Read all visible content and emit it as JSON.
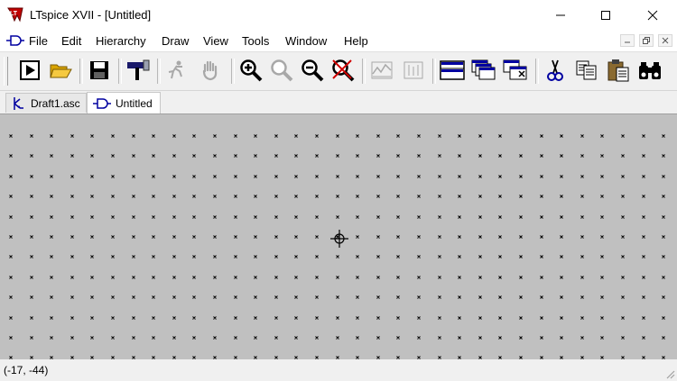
{
  "window": {
    "title": "LTspice XVII - [Untitled]"
  },
  "menu": {
    "items": [
      {
        "label": "File"
      },
      {
        "label": "Edit"
      },
      {
        "label": "Hierarchy"
      },
      {
        "label": "Draw"
      },
      {
        "label": "View"
      },
      {
        "label": "Tools"
      },
      {
        "label": "Window"
      },
      {
        "label": "Help"
      }
    ]
  },
  "toolbar": {
    "buttons": [
      {
        "icon": "run-icon"
      },
      {
        "icon": "open-folder-icon"
      },
      {
        "icon": "save-icon"
      },
      {
        "icon": "control-panel-hammer-icon"
      },
      {
        "icon": "halt-running-icon"
      },
      {
        "icon": "pan-hand-icon"
      },
      {
        "icon": "zoom-in-icon"
      },
      {
        "icon": "zoom-area-icon"
      },
      {
        "icon": "zoom-out-icon"
      },
      {
        "icon": "zoom-full-icon"
      },
      {
        "icon": "autoscale-icon"
      },
      {
        "icon": "delete-trace-icon"
      },
      {
        "icon": "tile-horizontal-icon"
      },
      {
        "icon": "cascade-icon"
      },
      {
        "icon": "close-windows-icon"
      },
      {
        "icon": "cut-icon"
      },
      {
        "icon": "copy-icon"
      },
      {
        "icon": "paste-icon"
      },
      {
        "icon": "find-binoculars-icon"
      }
    ]
  },
  "tabs": [
    {
      "label": "Draft1.asc",
      "active": false
    },
    {
      "label": "Untitled",
      "active": true
    }
  ],
  "status": {
    "coords": "(-17, -44)"
  },
  "colors": {
    "canvas": "#c0c0c0",
    "grid_dot": "#000000",
    "accent_blue": "#0000a0"
  }
}
